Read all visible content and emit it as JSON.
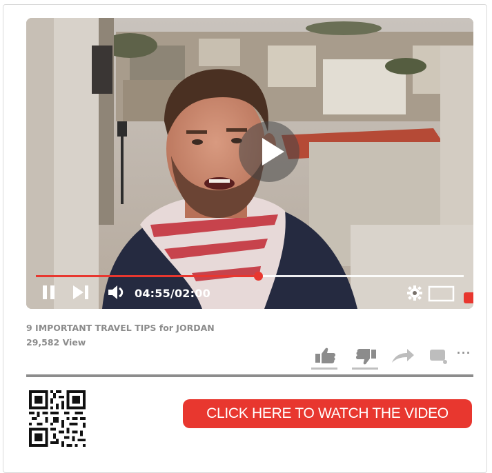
{
  "video": {
    "current_time": "04:55",
    "duration": "02:00",
    "time_display": "04:55/02:00",
    "progress": 0.52
  },
  "meta": {
    "title": "9 IMPORTANT TRAVEL TIPS for JORDAN",
    "views": "29,582  View"
  },
  "actions": {
    "items": [
      "like-icon",
      "dislike-icon",
      "share-icon",
      "comment-icon",
      "more-icon"
    ],
    "more_label": "···"
  },
  "cta": {
    "label": "CLICK HERE TO WATCH THE VIDEO"
  },
  "colors": {
    "accent": "#e8372f",
    "text_muted": "#8c8c8c",
    "icon": "#8c8c8c",
    "divider": "#8c8c8c"
  }
}
